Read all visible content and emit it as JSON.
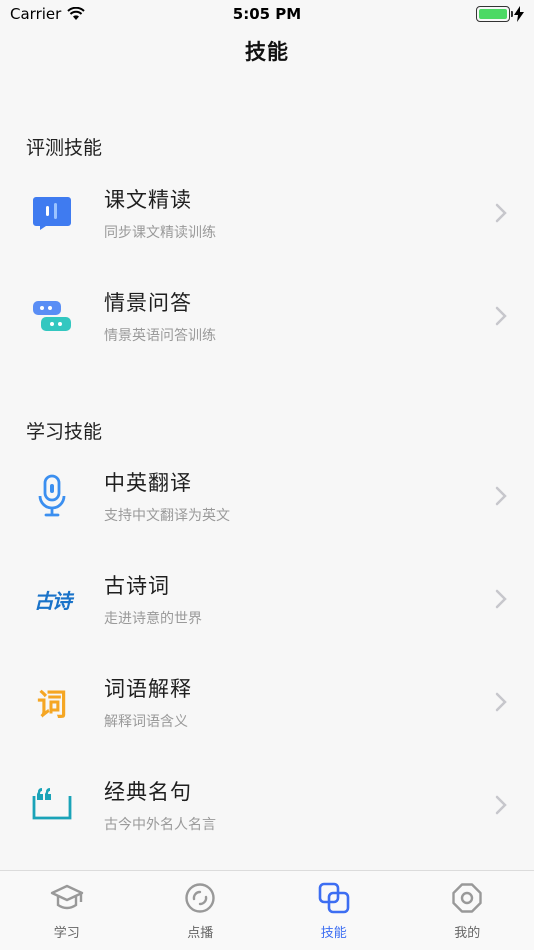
{
  "status": {
    "carrier": "Carrier",
    "time": "5:05 PM"
  },
  "header": {
    "title": "技能"
  },
  "sections": [
    {
      "title": "评测技能",
      "items": [
        {
          "title": "课文精读",
          "subtitle": "同步课文精读训练",
          "icon": "speech-bubble-icon"
        },
        {
          "title": "情景问答",
          "subtitle": "情景英语问答训练",
          "icon": "chat-bubbles-icon"
        }
      ]
    },
    {
      "title": "学习技能",
      "items": [
        {
          "title": "中英翻译",
          "subtitle": "支持中文翻译为英文",
          "icon": "microphone-icon"
        },
        {
          "title": "古诗词",
          "subtitle": "走进诗意的世界",
          "icon": "poem-calligraphy-icon",
          "glyph": "古诗"
        },
        {
          "title": "词语解释",
          "subtitle": "解释词语含义",
          "icon": "word-glyph-icon",
          "glyph": "词"
        },
        {
          "title": "经典名句",
          "subtitle": "古今中外名人名言",
          "icon": "quote-book-icon"
        }
      ]
    }
  ],
  "tabs": [
    {
      "label": "学习",
      "icon": "graduation-cap-icon",
      "active": false
    },
    {
      "label": "点播",
      "icon": "disc-icon",
      "active": false
    },
    {
      "label": "技能",
      "icon": "skills-squares-icon",
      "active": true
    },
    {
      "label": "我的",
      "icon": "profile-octagon-icon",
      "active": false
    }
  ],
  "colors": {
    "accent": "#3d6ef2",
    "battery": "#4cd964",
    "poem": "#1a73c9",
    "word": "#f5a623",
    "quote": "#1aa3b8"
  }
}
